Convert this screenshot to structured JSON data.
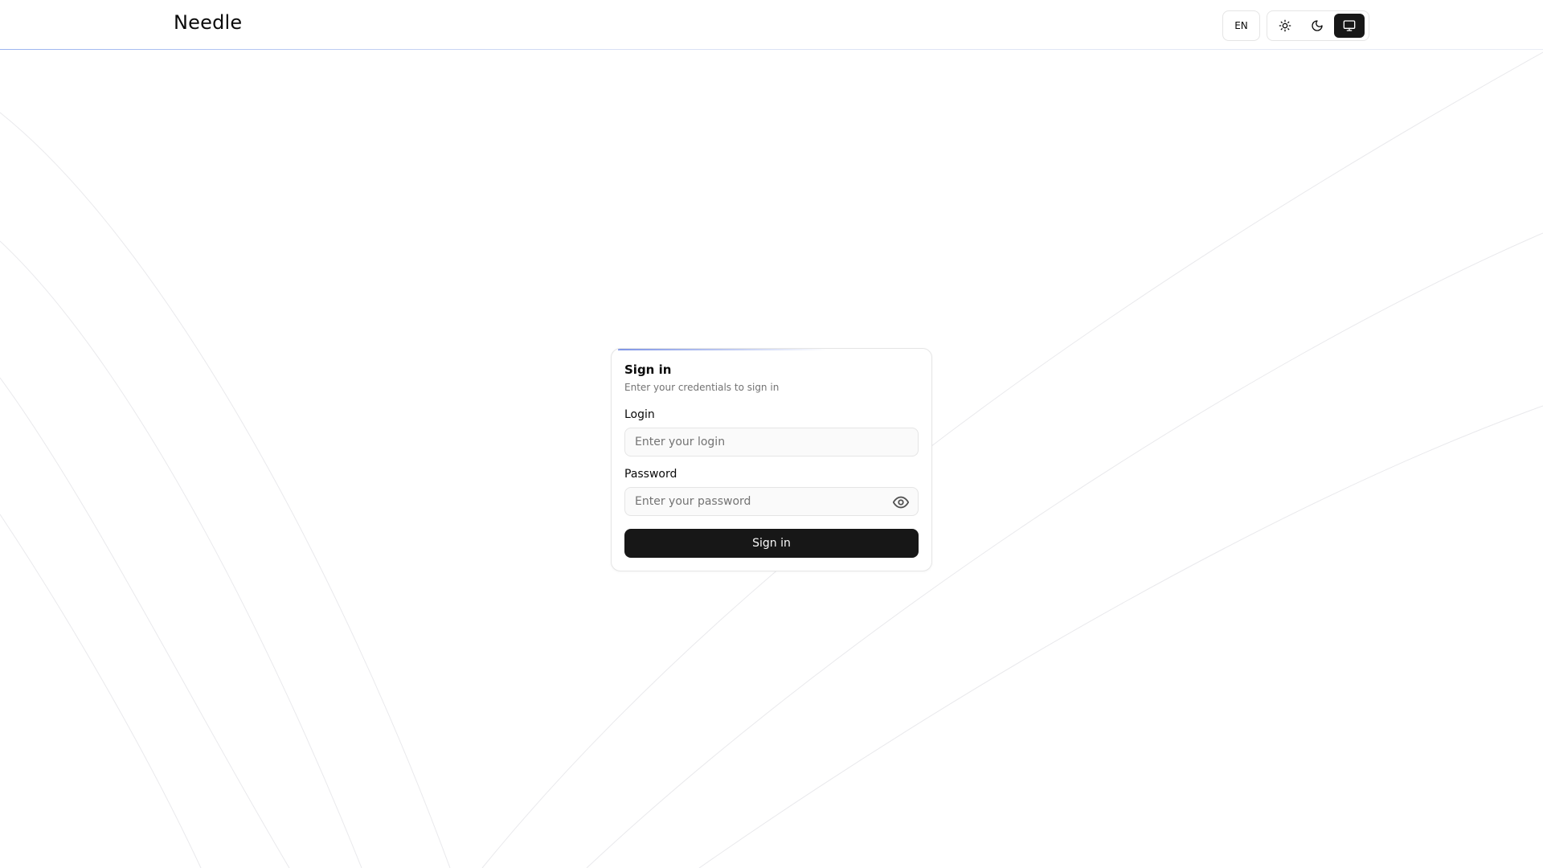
{
  "app": {
    "brand": "Needle"
  },
  "header": {
    "language_label": "EN",
    "theme_options": [
      {
        "name": "light",
        "icon": "sun-icon",
        "active": false
      },
      {
        "name": "dark",
        "icon": "moon-icon",
        "active": false
      },
      {
        "name": "system",
        "icon": "monitor-icon",
        "active": true
      }
    ]
  },
  "signin": {
    "title": "Sign in",
    "description": "Enter your credentials to sign in",
    "login_label": "Login",
    "login_placeholder": "Enter your login",
    "login_value": "",
    "password_label": "Password",
    "password_placeholder": "Enter your password",
    "password_value": "",
    "toggle_visibility_icon": "eye-icon",
    "submit_label": "Sign in"
  },
  "colors": {
    "primary": "#171717",
    "primary_text": "#fafafa",
    "border": "#e5e5e5",
    "muted_text": "#737373",
    "accent": "#7f95e6"
  }
}
